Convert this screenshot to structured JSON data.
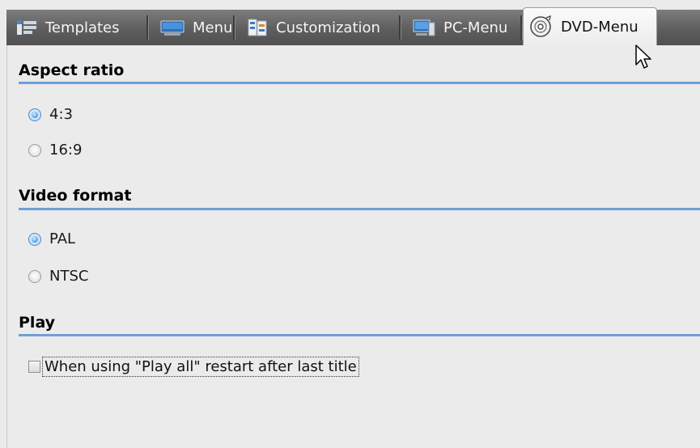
{
  "tabs": [
    {
      "label": "Templates",
      "icon": "templates-icon"
    },
    {
      "label": "Menu",
      "icon": "menu-monitor-icon"
    },
    {
      "label": "Customization",
      "icon": "customization-icon"
    },
    {
      "label": "PC-Menu",
      "icon": "pc-icon"
    },
    {
      "label": "DVD-Menu",
      "icon": "dvd-disc-icon",
      "active": true
    }
  ],
  "sections": {
    "aspect_ratio": {
      "title": "Aspect ratio",
      "options": [
        {
          "label": "4:3",
          "selected": true
        },
        {
          "label": "16:9",
          "selected": false
        }
      ]
    },
    "video_format": {
      "title": "Video format",
      "options": [
        {
          "label": "PAL",
          "selected": true
        },
        {
          "label": "NTSC",
          "selected": false
        }
      ]
    },
    "play": {
      "title": "Play",
      "checkbox_label": "When using \"Play all\" restart after last title",
      "checked": false
    }
  },
  "colors": {
    "accent_line": "#6da0d8",
    "tabstrip": "#5e5e5e",
    "background": "#ebebeb"
  }
}
